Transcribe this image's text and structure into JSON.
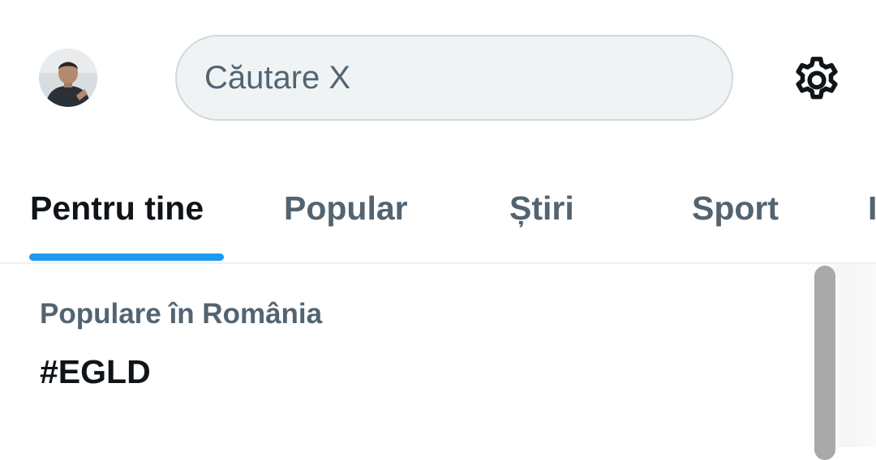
{
  "header": {
    "search_placeholder": "Căutare X",
    "avatar_icon": "user-avatar",
    "settings_icon": "gear-icon"
  },
  "tabs": [
    {
      "label": "Pentru tine",
      "active": true
    },
    {
      "label": "Popular",
      "active": false
    },
    {
      "label": "Știri",
      "active": false
    },
    {
      "label": "Sport",
      "active": false
    },
    {
      "label": "I",
      "active": false
    }
  ],
  "trend": {
    "context": "Populare în România",
    "name": "#EGLD"
  },
  "colors": {
    "accent": "#1d9bf0",
    "text_primary": "#0f1419",
    "text_secondary": "#536471",
    "search_bg": "#eff3f4"
  }
}
